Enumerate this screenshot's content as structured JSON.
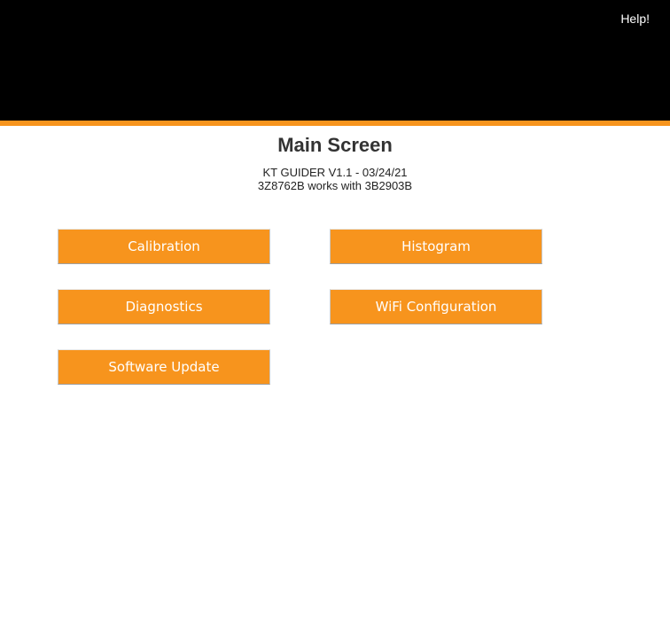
{
  "header": {
    "help_label": "Help!"
  },
  "main": {
    "title": "Main Screen",
    "version": "KT GUIDER V1.1 - 03/24/21",
    "compatibility": "3Z8762B works with 3B2903B"
  },
  "buttons": {
    "calibration": "Calibration",
    "histogram": "Histogram",
    "diagnostics": "Diagnostics",
    "wifi_configuration": "WiFi Configuration",
    "software_update": "Software Update"
  },
  "colors": {
    "accent": "#f7941d",
    "header_bg": "#000000"
  }
}
